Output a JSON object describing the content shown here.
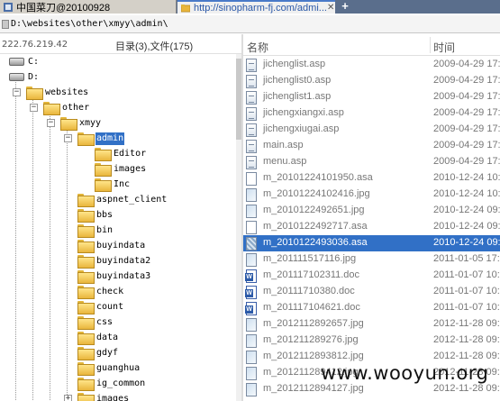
{
  "tabs": [
    {
      "label": "中国菜刀@20100928",
      "active": false
    },
    {
      "label": "http://sinopharm-fj.com/admi...",
      "active": true
    }
  ],
  "new_tab_label": "+",
  "path": "D:\\websites\\other\\xmyy\\admin\\",
  "info": {
    "ip": "222.76.219.42",
    "counts": "目录(3),文件(175)"
  },
  "tree": [
    {
      "label": "C:",
      "type": "drive",
      "depth": 0,
      "expander": ""
    },
    {
      "label": "D:",
      "type": "drive",
      "depth": 0,
      "expander": ""
    },
    {
      "label": "websites",
      "type": "folder",
      "depth": 1,
      "expander": "−"
    },
    {
      "label": "other",
      "type": "folder",
      "depth": 2,
      "expander": "−"
    },
    {
      "label": "xmyy",
      "type": "folder",
      "depth": 3,
      "expander": "−"
    },
    {
      "label": "admin",
      "type": "folder",
      "depth": 4,
      "expander": "−",
      "selected": true
    },
    {
      "label": "Editor",
      "type": "folder",
      "depth": 5,
      "expander": ""
    },
    {
      "label": "images",
      "type": "folder",
      "depth": 5,
      "expander": ""
    },
    {
      "label": "Inc",
      "type": "folder",
      "depth": 5,
      "expander": ""
    },
    {
      "label": "aspnet_client",
      "type": "folder",
      "depth": 4,
      "expander": ""
    },
    {
      "label": "bbs",
      "type": "folder",
      "depth": 4,
      "expander": ""
    },
    {
      "label": "bin",
      "type": "folder",
      "depth": 4,
      "expander": ""
    },
    {
      "label": "buyindata",
      "type": "folder",
      "depth": 4,
      "expander": ""
    },
    {
      "label": "buyindata2",
      "type": "folder",
      "depth": 4,
      "expander": ""
    },
    {
      "label": "buyindata3",
      "type": "folder",
      "depth": 4,
      "expander": ""
    },
    {
      "label": "check",
      "type": "folder",
      "depth": 4,
      "expander": ""
    },
    {
      "label": "count",
      "type": "folder",
      "depth": 4,
      "expander": ""
    },
    {
      "label": "css",
      "type": "folder",
      "depth": 4,
      "expander": ""
    },
    {
      "label": "data",
      "type": "folder",
      "depth": 4,
      "expander": ""
    },
    {
      "label": "gdyf",
      "type": "folder",
      "depth": 4,
      "expander": ""
    },
    {
      "label": "guanghua",
      "type": "folder",
      "depth": 4,
      "expander": ""
    },
    {
      "label": "ig_common",
      "type": "folder",
      "depth": 4,
      "expander": ""
    },
    {
      "label": "images",
      "type": "folder",
      "depth": 4,
      "expander": "+"
    }
  ],
  "file_list": {
    "col_name": "名称",
    "col_time": "时间",
    "rows": [
      {
        "name": "jichenglist.asp",
        "time": "2009-04-29 17:0",
        "icon": "asp"
      },
      {
        "name": "jichenglist0.asp",
        "time": "2009-04-29 17:0",
        "icon": "asp"
      },
      {
        "name": "jichenglist1.asp",
        "time": "2009-04-29 17:0",
        "icon": "asp"
      },
      {
        "name": "jichengxiangxi.asp",
        "time": "2009-04-29 17:0",
        "icon": "asp"
      },
      {
        "name": "jichengxiugai.asp",
        "time": "2009-04-29 17:0",
        "icon": "asp"
      },
      {
        "name": "main.asp",
        "time": "2009-04-29 17:0",
        "icon": "asp"
      },
      {
        "name": "menu.asp",
        "time": "2009-04-29 17:0",
        "icon": "asp"
      },
      {
        "name": "m_20101224101950.asa",
        "time": "2010-12-24 10:",
        "icon": "asa"
      },
      {
        "name": "m_20101224102416.jpg",
        "time": "2010-12-24 10:",
        "icon": "img"
      },
      {
        "name": "m_2010122492651.jpg",
        "time": "2010-12-24 09:",
        "icon": "img"
      },
      {
        "name": "m_2010122492717.asa",
        "time": "2010-12-24 09:",
        "icon": "asa"
      },
      {
        "name": "m_2010122493036.asa",
        "time": "2010-12-24 09:",
        "icon": "pat",
        "selected": true
      },
      {
        "name": "m_201111517116.jpg",
        "time": "2011-01-05 17:",
        "icon": "img"
      },
      {
        "name": "m_201117102311.doc",
        "time": "2011-01-07 10:",
        "icon": "doc"
      },
      {
        "name": "m_20111710380.doc",
        "time": "2011-01-07 10:",
        "icon": "doc"
      },
      {
        "name": "m_201117104621.doc",
        "time": "2011-01-07 10:",
        "icon": "doc"
      },
      {
        "name": "m_2012112892657.jpg",
        "time": "2012-11-28 09:",
        "icon": "img"
      },
      {
        "name": "m_201211289276.jpg",
        "time": "2012-11-28 09:",
        "icon": "img"
      },
      {
        "name": "m_2012112893812.jpg",
        "time": "2012-11-28 09:",
        "icon": "img"
      },
      {
        "name": "m_201211289412.jpg",
        "time": "2012-11-28 09:",
        "icon": "img"
      },
      {
        "name": "m_2012112894127.jpg",
        "time": "2012-11-28 09:",
        "icon": "img"
      }
    ]
  },
  "watermark": "www.wooyun.org",
  "colors": {
    "selection": "#3170c6",
    "tabbar": "#5a6e8c",
    "folder": "#e9b63c"
  }
}
